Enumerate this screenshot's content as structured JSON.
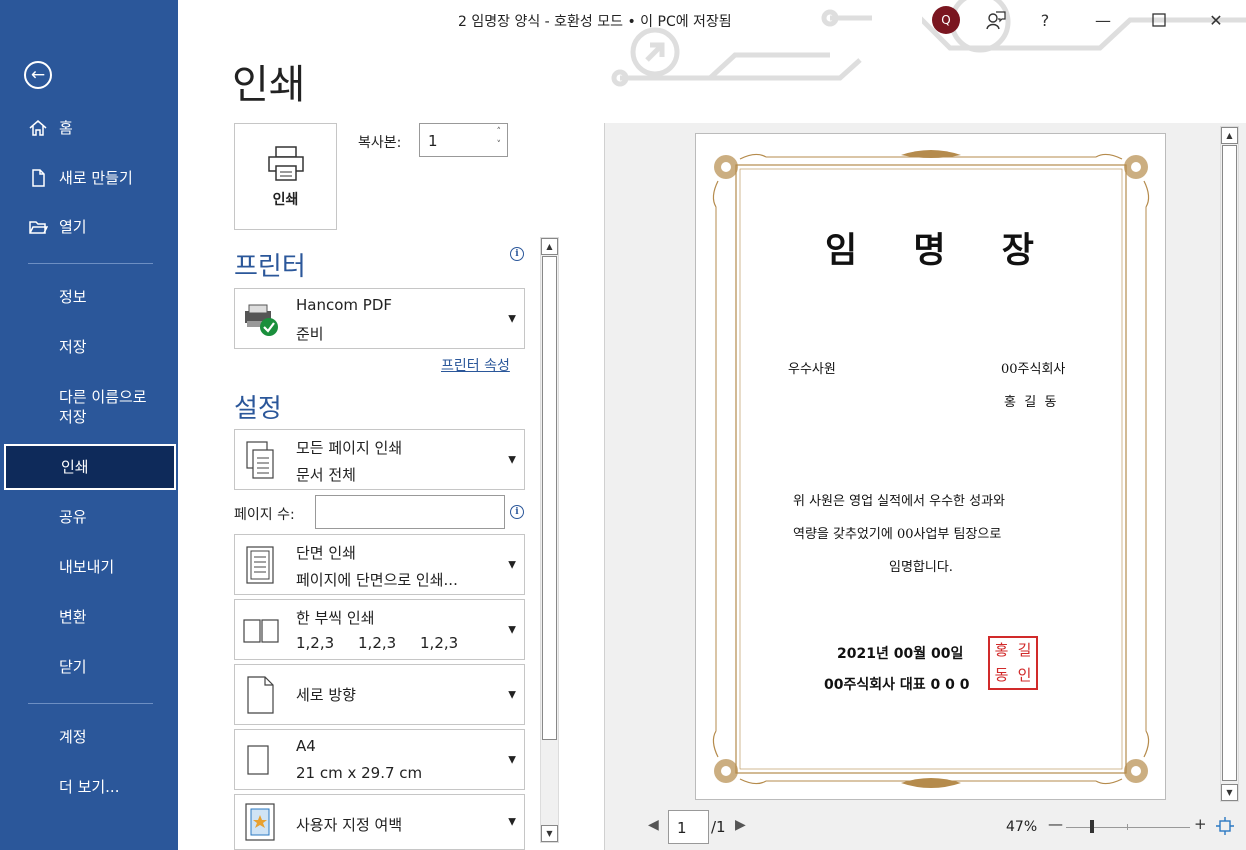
{
  "window": {
    "title": "2 임명장 양식  -  호환성 모드 • 이 PC에 저장됨",
    "avatar_initial": "Q",
    "help": "?",
    "minimize": "—",
    "close": "✕"
  },
  "sidebar": {
    "back_glyph": "←",
    "items": [
      {
        "label": "홈",
        "icon": "home-icon"
      },
      {
        "label": "새로 만들기",
        "icon": "new-document-icon"
      },
      {
        "label": "열기",
        "icon": "folder-open-icon"
      },
      {
        "label": "정보"
      },
      {
        "label": "저장"
      },
      {
        "label": "다른 이름으로\n저장"
      },
      {
        "label": "인쇄",
        "active": true
      },
      {
        "label": "공유"
      },
      {
        "label": "내보내기"
      },
      {
        "label": "변환"
      },
      {
        "label": "닫기"
      },
      {
        "label": "계정"
      },
      {
        "label": "더 보기..."
      }
    ]
  },
  "print": {
    "title": "인쇄",
    "button_label": "인쇄",
    "copies_label": "복사본:",
    "copies_value": "1",
    "printer_heading": "프린터",
    "printer_name": "Hancom PDF",
    "printer_status": "준비",
    "printer_properties": "프린터 속성",
    "settings_heading": "설정",
    "pages_label": "페이지 수:",
    "settings": {
      "range_l1": "모든 페이지 인쇄",
      "range_l2": "문서 전체",
      "sides_l1": "단면 인쇄",
      "sides_l2": "페이지에 단면으로 인쇄...",
      "collate_l1": "한 부씩 인쇄",
      "collate_l2": "1,2,3     1,2,3     1,2,3",
      "orientation": "세로 방향",
      "paper_l1": "A4",
      "paper_l2": "21 cm x 29.7 cm",
      "margins": "사용자 지정 여백"
    }
  },
  "document": {
    "title": "임 명 장",
    "left_label": "우수사원",
    "company": "00주식회사",
    "name": "홍  길  동",
    "body_line1": "위 사원은 영업 실적에서 우수한 성과와",
    "body_line2": "역량을 갖추었기에 00사업부 팀장으로",
    "body_line3": "임명합니다.",
    "date": "2021년 00월 00일",
    "signature": "00주식회사 대표 0 0 0",
    "seal_chars": [
      "홍",
      "길",
      "동",
      "인"
    ]
  },
  "preview_nav": {
    "page_value": "1",
    "page_total": "/1",
    "zoom": "47%",
    "zoom_minus": "—",
    "zoom_plus": "+",
    "zoom_level": 0.47
  }
}
